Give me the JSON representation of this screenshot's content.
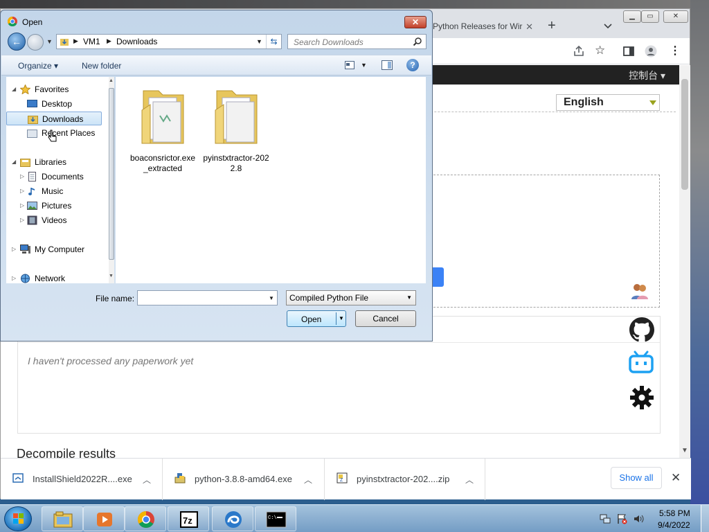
{
  "dialog": {
    "title": "Open",
    "breadcrumb": [
      "VM1",
      "Downloads"
    ],
    "search_placeholder": "Search Downloads",
    "toolbar": {
      "organize": "Organize",
      "new_folder": "New folder"
    },
    "nav": {
      "favorites": "Favorites",
      "desktop": "Desktop",
      "downloads": "Downloads",
      "recent_places": "Recent Places",
      "libraries": "Libraries",
      "documents": "Documents",
      "music": "Music",
      "pictures": "Pictures",
      "videos": "Videos",
      "my_computer": "My Computer",
      "network": "Network"
    },
    "files": [
      {
        "name": "boaconsrictor.exe_extracted"
      },
      {
        "name": "pyinstxtractor-2022.8"
      }
    ],
    "file_name_label": "File name:",
    "file_name_value": "",
    "file_type": "Compiled Python File",
    "open_label": "Open",
    "cancel_label": "Cancel"
  },
  "browser": {
    "tab_title": "Python Releases for Wir",
    "console_link": "控制台",
    "language": "English",
    "empty_message": "I haven't processed any paperwork yet",
    "decompile_title": "Decompile results"
  },
  "downloads": [
    {
      "name": "InstallShield2022R....exe"
    },
    {
      "name": "python-3.8.8-amd64.exe"
    },
    {
      "name": "pyinstxtractor-202....zip"
    }
  ],
  "show_all": "Show all",
  "taskbar": {
    "time": "5:58 PM",
    "date": "9/4/2022"
  }
}
